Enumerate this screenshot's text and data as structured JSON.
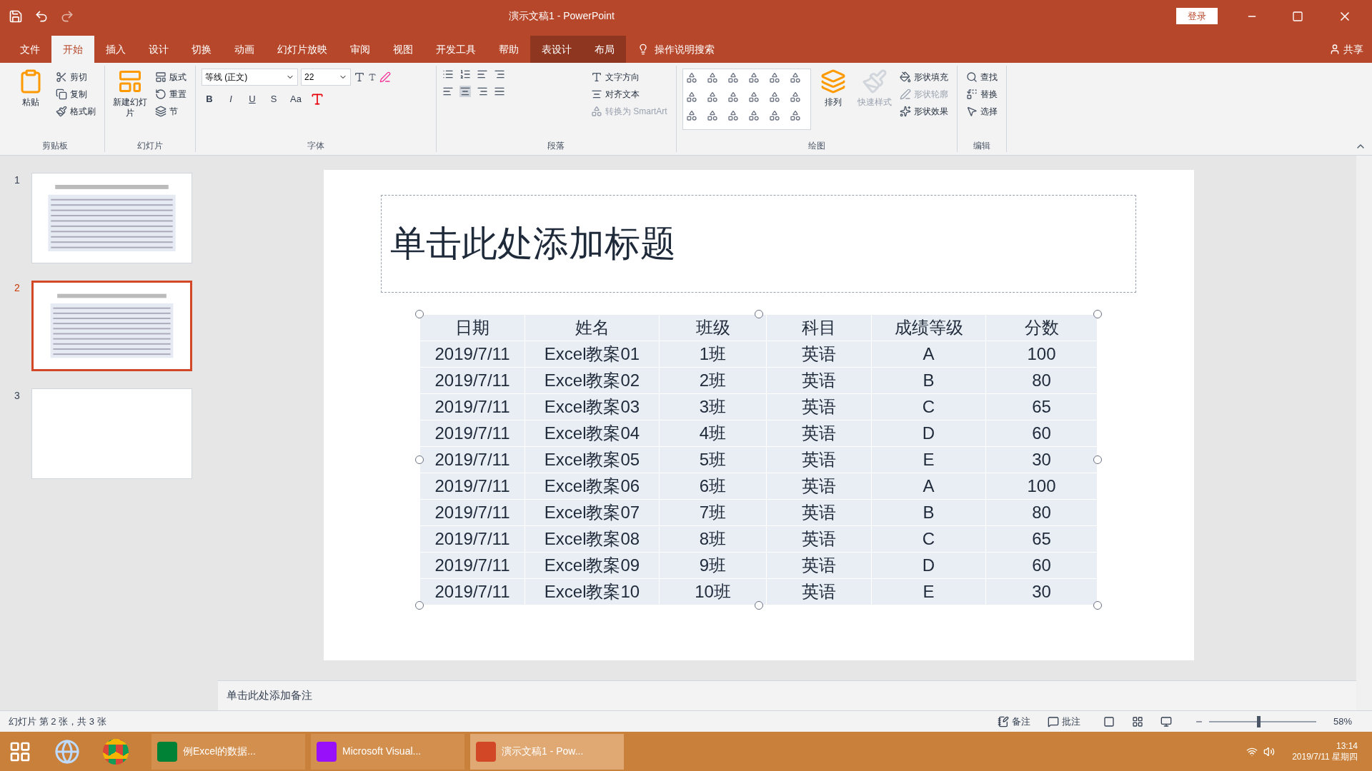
{
  "window": {
    "title": "演示文稿1 - PowerPoint",
    "login": "登录",
    "share": "共享"
  },
  "tabs": [
    {
      "label": "文件",
      "selected": false,
      "contextual": false
    },
    {
      "label": "开始",
      "selected": true,
      "contextual": false
    },
    {
      "label": "插入",
      "selected": false,
      "contextual": false
    },
    {
      "label": "设计",
      "selected": false,
      "contextual": false
    },
    {
      "label": "切换",
      "selected": false,
      "contextual": false
    },
    {
      "label": "动画",
      "selected": false,
      "contextual": false
    },
    {
      "label": "幻灯片放映",
      "selected": false,
      "contextual": false
    },
    {
      "label": "审阅",
      "selected": false,
      "contextual": false
    },
    {
      "label": "视图",
      "selected": false,
      "contextual": false
    },
    {
      "label": "开发工具",
      "selected": false,
      "contextual": false
    },
    {
      "label": "帮助",
      "selected": false,
      "contextual": false
    },
    {
      "label": "表设计",
      "selected": false,
      "contextual": true
    },
    {
      "label": "布局",
      "selected": false,
      "contextual": true
    }
  ],
  "tell_me": "操作说明搜索",
  "ribbon": {
    "groups": [
      {
        "kind": "clipboard",
        "name": "剪贴板",
        "big": [
          {
            "label": "粘贴",
            "disabled": false
          }
        ],
        "small": [
          {
            "label": "剪切",
            "disabled": false
          },
          {
            "label": "复制",
            "disabled": false
          },
          {
            "label": "格式刷",
            "disabled": false
          }
        ]
      },
      {
        "kind": "slides",
        "name": "幻灯片",
        "big": [
          {
            "label": "新建幻灯片",
            "disabled": false
          }
        ],
        "small": [
          {
            "label": "版式",
            "disabled": false
          },
          {
            "label": "重置",
            "disabled": false
          },
          {
            "label": "节",
            "disabled": false
          }
        ]
      },
      {
        "kind": "font",
        "name": "字体",
        "font": "等线 (正文)",
        "size": "22",
        "format_buttons": [
          "B",
          "I",
          "U",
          "S"
        ],
        "case_button": "Aa"
      },
      {
        "kind": "paragraph",
        "name": "段落",
        "small": [
          {
            "label": "文字方向",
            "disabled": false
          },
          {
            "label": "对齐文本",
            "disabled": false
          },
          {
            "label": "转换为 SmartArt",
            "disabled": true
          }
        ]
      },
      {
        "kind": "drawing",
        "name": "绘图",
        "big": [
          {
            "label": "排列",
            "disabled": false
          },
          {
            "label": "快速样式",
            "disabled": true
          }
        ],
        "small": [
          {
            "label": "形状填充",
            "disabled": false
          },
          {
            "label": "形状轮廓",
            "disabled": true
          },
          {
            "label": "形状效果",
            "disabled": false
          }
        ]
      },
      {
        "kind": "editing",
        "name": "编辑",
        "small": [
          {
            "label": "查找",
            "disabled": false
          },
          {
            "label": "替换",
            "disabled": false
          },
          {
            "label": "选择",
            "disabled": false
          }
        ]
      }
    ]
  },
  "slides": [
    {
      "number": "1",
      "selected": false,
      "kind": "table"
    },
    {
      "number": "2",
      "selected": true,
      "kind": "table"
    },
    {
      "number": "3",
      "selected": false,
      "kind": "blank"
    }
  ],
  "slide": {
    "title_placeholder": "单击此处添加标题",
    "table": {
      "columns": [
        "日期",
        "姓名",
        "班级",
        "科目",
        "成绩等级",
        "分数"
      ],
      "rows": [
        [
          "2019/7/11",
          "Excel教案01",
          "1班",
          "英语",
          "A",
          "100"
        ],
        [
          "2019/7/11",
          "Excel教案02",
          "2班",
          "英语",
          "B",
          "80"
        ],
        [
          "2019/7/11",
          "Excel教案03",
          "3班",
          "英语",
          "C",
          "65"
        ],
        [
          "2019/7/11",
          "Excel教案04",
          "4班",
          "英语",
          "D",
          "60"
        ],
        [
          "2019/7/11",
          "Excel教案05",
          "5班",
          "英语",
          "E",
          "30"
        ],
        [
          "2019/7/11",
          "Excel教案06",
          "6班",
          "英语",
          "A",
          "100"
        ],
        [
          "2019/7/11",
          "Excel教案07",
          "7班",
          "英语",
          "B",
          "80"
        ],
        [
          "2019/7/11",
          "Excel教案08",
          "8班",
          "英语",
          "C",
          "65"
        ],
        [
          "2019/7/11",
          "Excel教案09",
          "9班",
          "英语",
          "D",
          "60"
        ],
        [
          "2019/7/11",
          "Excel教案10",
          "10班",
          "英语",
          "E",
          "30"
        ]
      ]
    }
  },
  "notes_placeholder": "单击此处添加备注",
  "status_bar": {
    "slide_info": "幻灯片 第 2 张，共 3 张",
    "notes": "备注",
    "comments": "批注",
    "zoom": "58%",
    "level": 0.45
  },
  "taskbar": {
    "apps": [
      {
        "kind": "excel",
        "label": "例Excel的数据...",
        "selected": false
      },
      {
        "kind": "vs",
        "label": "Microsoft Visual...",
        "selected": false
      },
      {
        "kind": "ppt",
        "label": "演示文稿1 - Pow...",
        "selected": true
      }
    ],
    "time": "13:14",
    "date": "2019/7/11 星期四"
  }
}
